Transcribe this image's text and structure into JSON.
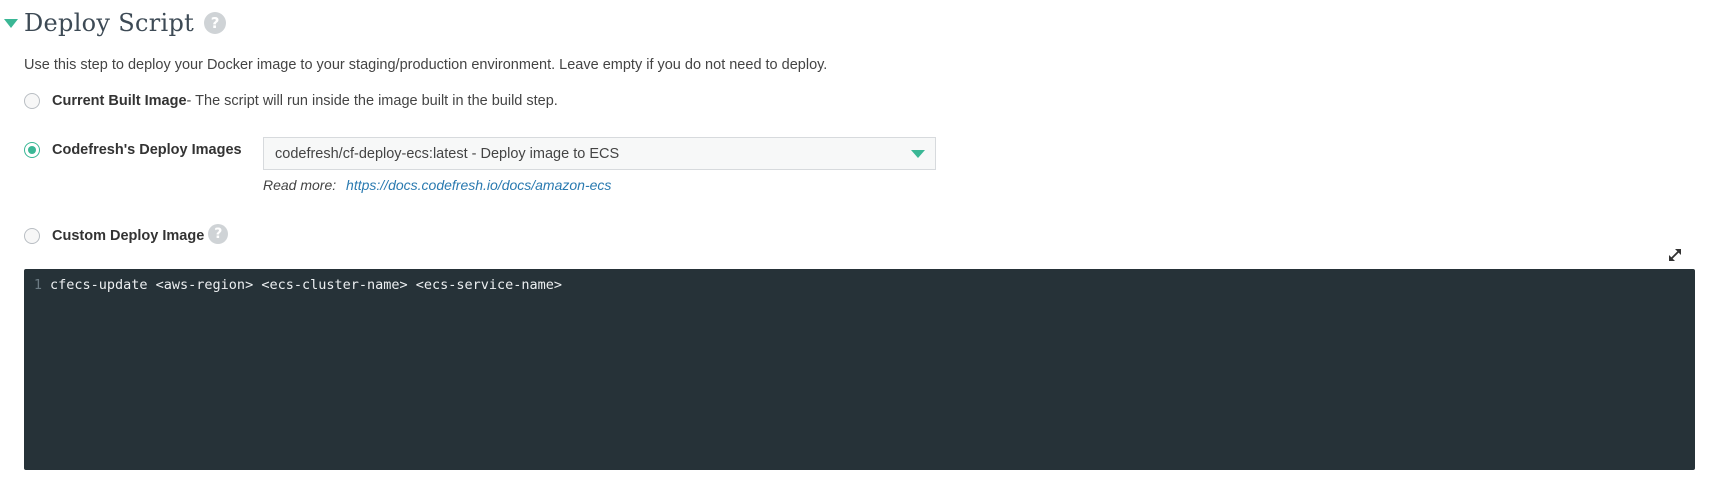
{
  "section": {
    "title": "Deploy Script",
    "help_icon": "?",
    "description": "Use this step to deploy your Docker image to your staging/production environment. Leave empty if you do not need to deploy."
  },
  "options": {
    "current": {
      "label": "Current Built Image",
      "description": " - The script will run inside the image built in the build step.",
      "selected": false
    },
    "codefresh": {
      "label": "Codefresh's Deploy Images",
      "selected": true,
      "select_value": "codefresh/cf-deploy-ecs:latest - Deploy image to ECS",
      "read_more_label": "Read more:",
      "read_more_link": "https://docs.codefresh.io/docs/amazon-ecs"
    },
    "custom": {
      "label": "Custom Deploy Image",
      "help_icon": "?",
      "selected": false
    }
  },
  "editor": {
    "lines": [
      {
        "number": "1",
        "text": "cfecs-update <aws-region> <ecs-cluster-name> <ecs-service-name>"
      }
    ]
  },
  "colors": {
    "accent": "#3ab795",
    "editor_bg": "#263238",
    "link": "#2a7ab0"
  },
  "icons": {
    "collapse": "caret-down-icon",
    "help": "help-circle-icon",
    "select_caret": "chevron-down-icon",
    "expand": "expand-icon"
  }
}
